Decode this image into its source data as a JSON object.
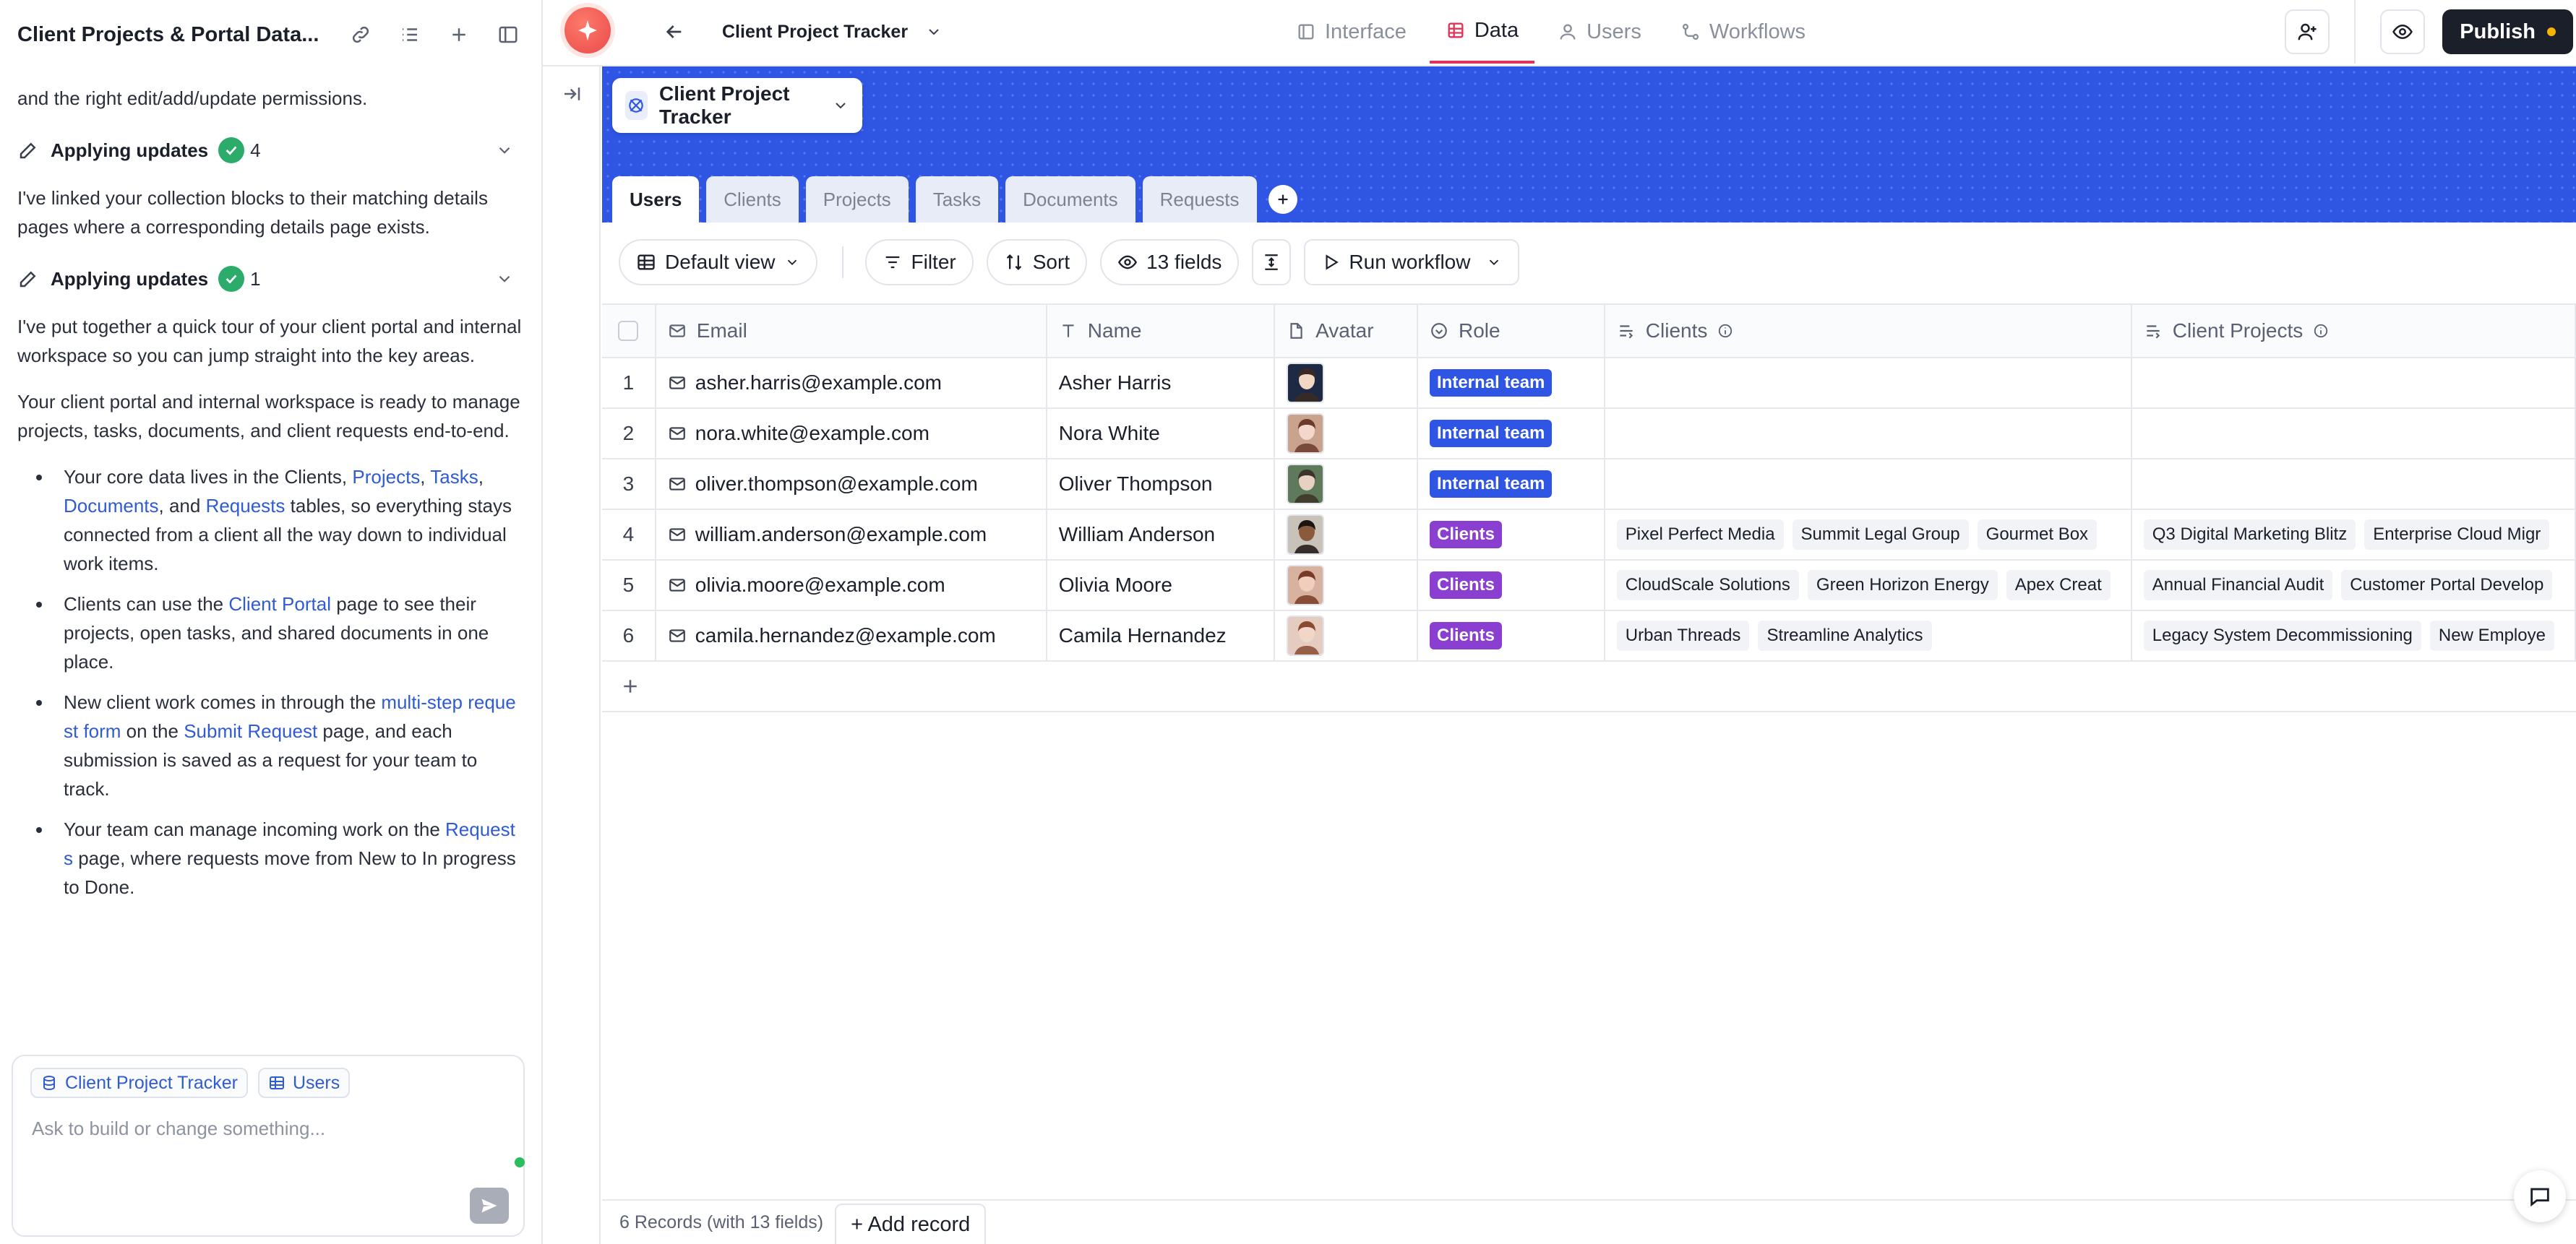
{
  "left_panel": {
    "title": "Client Projects & Portal Data...",
    "intro_tail": "and the right edit/add/update permissions.",
    "step1": {
      "label": "Applying updates",
      "count": "4"
    },
    "msg1": "I've linked your collection blocks to their matching details pages where a corresponding details page exists.",
    "step2": {
      "label": "Applying updates",
      "count": "1"
    },
    "msg2": "I've put together a quick tour of your client portal and internal workspace so you can jump straight into the key areas.",
    "msg3": "Your client portal and internal workspace is ready to manage projects, tasks, documents, and client requests end-to-end.",
    "b1": {
      "t1": "Your core data lives in the Clients, ",
      "l1": "Projects",
      "t2": ", ",
      "l2": "Tasks",
      "t3": ", ",
      "l3": "Documents",
      "t4": ", and ",
      "l4": "Requests",
      "t5": " tables, so everything stays connected from a client all the way down to individual work items."
    },
    "b2": {
      "t1": "Clients can use the ",
      "l1": "Client Portal",
      "t2": " page to see their projects, open tasks, and shared documents in one place."
    },
    "b3": {
      "t1": "New client work comes in through the ",
      "l1": "multi-step request form",
      "t2": " on the ",
      "l2": "Submit Request",
      "t3": " page, and each submission is saved as a request for your team to track."
    },
    "b4": {
      "t1": "Your team can manage incoming work on the ",
      "l1": "Requests",
      "t2": " page, where requests move from New to In progress to Done."
    },
    "composer": {
      "chip1": "Client Project Tracker",
      "chip2": "Users",
      "placeholder": "Ask to build or change something..."
    }
  },
  "topbar": {
    "app_name": "Client Project Tracker",
    "nav": [
      {
        "label": "Interface",
        "icon": "layout-icon"
      },
      {
        "label": "Data",
        "icon": "table-icon"
      },
      {
        "label": "Users",
        "icon": "user-icon"
      },
      {
        "label": "Workflows",
        "icon": "workflow-icon"
      }
    ],
    "publish_label": "Publish"
  },
  "database": {
    "name": "Client Project Tracker",
    "tabs": [
      "Users",
      "Clients",
      "Projects",
      "Tasks",
      "Documents",
      "Requests"
    ],
    "active_tab": "Users"
  },
  "toolbar": {
    "view": "Default view",
    "filter": "Filter",
    "sort": "Sort",
    "fields": "13 fields",
    "run_workflow": "Run workflow"
  },
  "table": {
    "columns": [
      "Email",
      "Name",
      "Avatar",
      "Role",
      "Clients",
      "Client Projects"
    ],
    "rows": [
      {
        "n": "1",
        "email": "asher.harris@example.com",
        "name": "Asher Harris",
        "role": "Internal team",
        "clients": [],
        "projects": []
      },
      {
        "n": "2",
        "email": "nora.white@example.com",
        "name": "Nora White",
        "role": "Internal team",
        "clients": [],
        "projects": []
      },
      {
        "n": "3",
        "email": "oliver.thompson@example.com",
        "name": "Oliver Thompson",
        "role": "Internal team",
        "clients": [],
        "projects": []
      },
      {
        "n": "4",
        "email": "william.anderson@example.com",
        "name": "William Anderson",
        "role": "Clients",
        "clients": [
          "Pixel Perfect Media",
          "Summit Legal Group",
          "Gourmet Box"
        ],
        "projects": [
          "Q3 Digital Marketing Blitz",
          "Enterprise Cloud Migr"
        ]
      },
      {
        "n": "5",
        "email": "olivia.moore@example.com",
        "name": "Olivia Moore",
        "role": "Clients",
        "clients": [
          "CloudScale Solutions",
          "Green Horizon Energy",
          "Apex Creat"
        ],
        "projects": [
          "Annual Financial Audit",
          "Customer Portal Develop"
        ]
      },
      {
        "n": "6",
        "email": "camila.hernandez@example.com",
        "name": "Camila Hernandez",
        "role": "Clients",
        "clients": [
          "Urban Threads",
          "Streamline Analytics"
        ],
        "projects": [
          "Legacy System Decommissioning",
          "New Employe"
        ]
      }
    ]
  },
  "footer": {
    "record_count": "6 Records (with 13 fields)",
    "add_record": "+ Add record"
  },
  "colors": {
    "accent": "#2f55e4",
    "nav_active": "#e0335a",
    "role_internal": "#2f55e4",
    "role_clients": "#8a3fd1",
    "success": "#2bac6a"
  }
}
